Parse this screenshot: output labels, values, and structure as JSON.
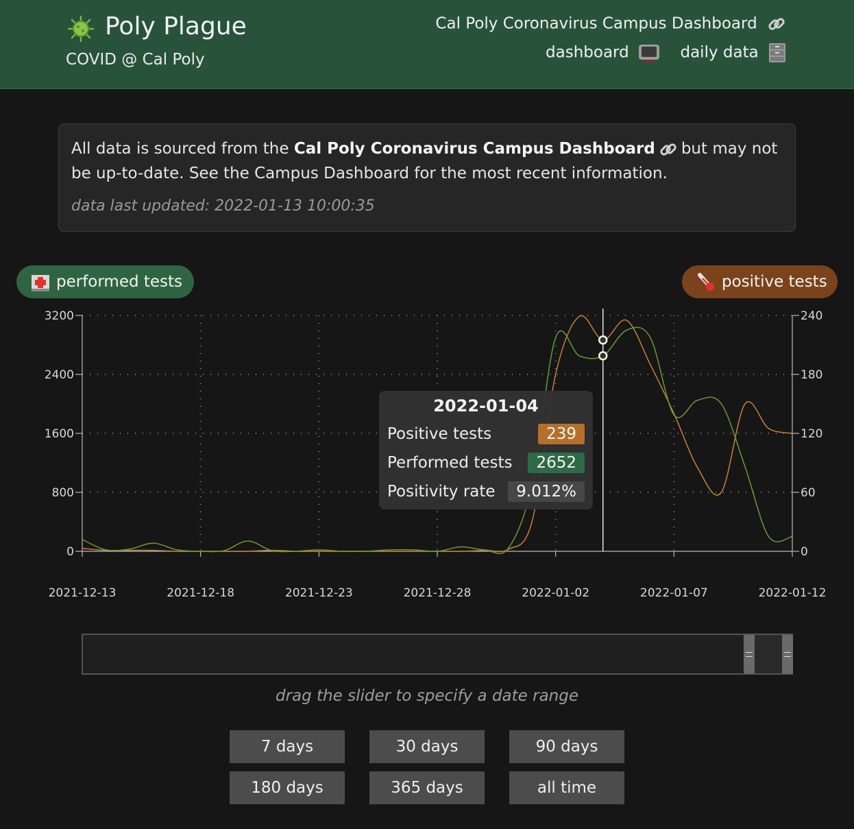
{
  "header": {
    "title": "Poly Plague",
    "subtitle": "COVID @ Cal Poly",
    "links": {
      "campus_dashboard": "Cal Poly Coronavirus Campus Dashboard",
      "dashboard": "dashboard",
      "daily_data": "daily data"
    },
    "icons": {
      "logo": "virus-icon",
      "chain": "link-icon",
      "tv": "television-icon",
      "cabinet": "file-cabinet-icon"
    }
  },
  "notice": {
    "text_before": "All data is sourced from the",
    "source_name": "Cal Poly Coronavirus Campus Dashboard",
    "text_after": "but may not be up-to-date. See the Campus Dashboard for the most recent information.",
    "updated": "data last updated: 2022-01-13 10:00:35"
  },
  "toggles": {
    "performed": {
      "label": "performed tests",
      "icon": "hospital-icon",
      "color": "#2f6442"
    },
    "positive": {
      "label": "positive tests",
      "icon": "thermometer-icon",
      "color": "#7a431c"
    }
  },
  "tooltip": {
    "date": "2022-01-04",
    "rows": [
      {
        "label": "Positive tests",
        "value": "239"
      },
      {
        "label": "Performed tests",
        "value": "2652"
      },
      {
        "label": "Positivity rate",
        "value": "9.012%"
      }
    ]
  },
  "chart_data": {
    "type": "line",
    "x": [
      "2021-12-13",
      "2021-12-14",
      "2021-12-15",
      "2021-12-16",
      "2021-12-17",
      "2021-12-18",
      "2021-12-19",
      "2021-12-20",
      "2021-12-21",
      "2021-12-22",
      "2021-12-23",
      "2021-12-24",
      "2021-12-25",
      "2021-12-26",
      "2021-12-27",
      "2021-12-28",
      "2021-12-29",
      "2021-12-30",
      "2021-12-31",
      "2022-01-01",
      "2022-01-02",
      "2022-01-03",
      "2022-01-04",
      "2022-01-05",
      "2022-01-06",
      "2022-01-07",
      "2022-01-08",
      "2022-01-09",
      "2022-01-10",
      "2022-01-11",
      "2022-01-12"
    ],
    "series": [
      {
        "name": "Positive tests",
        "axis": "right",
        "color": "#c8823a",
        "values": [
          3,
          1,
          1,
          1,
          0,
          0,
          0,
          0,
          1,
          0,
          0,
          0,
          0,
          0,
          0,
          0,
          0,
          1,
          2,
          30,
          180,
          239,
          215,
          235,
          190,
          140,
          85,
          60,
          150,
          125,
          120
        ]
      },
      {
        "name": "Performed tests",
        "axis": "left",
        "color": "#6a9a3a",
        "values": [
          160,
          20,
          30,
          110,
          20,
          0,
          10,
          140,
          10,
          0,
          20,
          0,
          0,
          20,
          20,
          0,
          60,
          20,
          40,
          900,
          2900,
          2652,
          2652,
          3000,
          2900,
          1850,
          2050,
          2000,
          1150,
          200,
          200
        ]
      }
    ],
    "x_ticks": [
      "2021-12-13",
      "2021-12-18",
      "2021-12-23",
      "2021-12-28",
      "2022-01-02",
      "2022-01-07",
      "2022-01-12"
    ],
    "y_left_ticks": [
      0,
      800,
      1600,
      2400,
      3200
    ],
    "y_right_ticks": [
      0,
      60,
      120,
      180,
      240
    ],
    "y_left_lim": [
      0,
      3200
    ],
    "y_right_lim": [
      0,
      240
    ],
    "grid": true,
    "highlight": "2022-01-04"
  },
  "slider": {
    "hint": "drag the slider to specify a date range"
  },
  "range_buttons": [
    "7 days",
    "30 days",
    "90 days",
    "180 days",
    "365 days",
    "all time"
  ]
}
